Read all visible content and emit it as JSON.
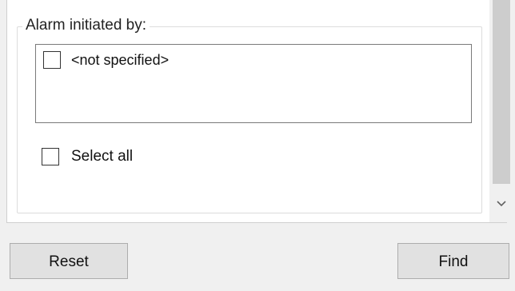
{
  "alarm_filter": {
    "group_title": "Alarm initiated by:",
    "items": [
      {
        "label": "<not specified>",
        "checked": false
      }
    ],
    "select_all_label": "Select all",
    "select_all_checked": false
  },
  "scrollbar": {
    "down_arrow_icon": "chevron-down-icon"
  },
  "actions": {
    "reset_label": "Reset",
    "find_label": "Find"
  }
}
